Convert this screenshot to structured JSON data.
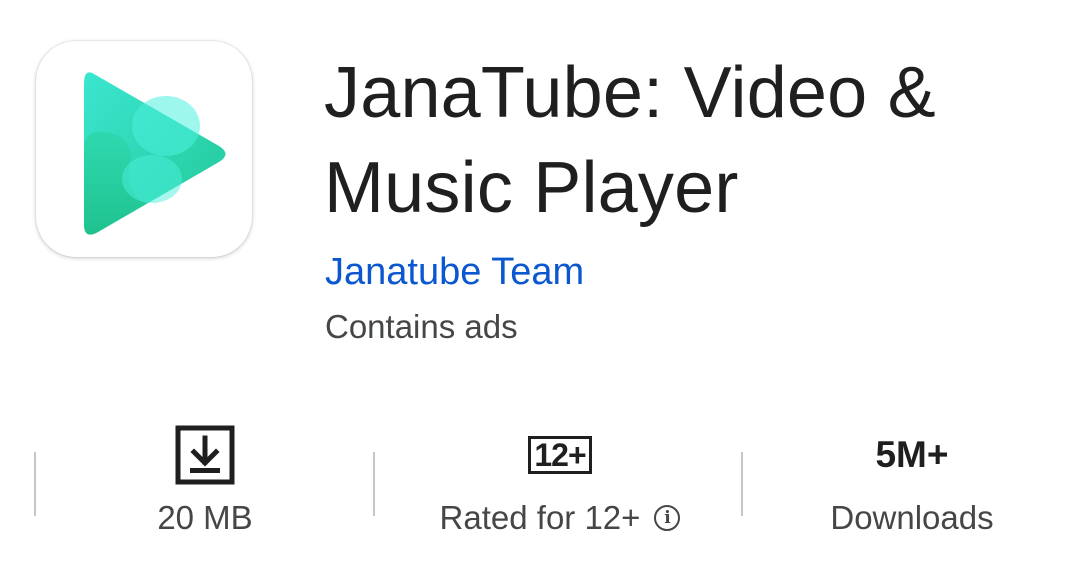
{
  "app": {
    "title": "JanaTube: Video & Music Player",
    "developer": "Janatube Team",
    "ads_note": "Contains ads",
    "icon": "play-triangle-logo",
    "brand_colors": [
      "#2fe0b9",
      "#29c9a0",
      "#3de8d3"
    ]
  },
  "stats": {
    "size": {
      "icon": "download-icon",
      "label": "20 MB"
    },
    "rating": {
      "badge": "12+",
      "label": "Rated for 12+",
      "info_icon": "info-icon"
    },
    "downloads": {
      "value": "5M+",
      "label": "Downloads"
    }
  },
  "colors": {
    "developer_link": "#0b57d0",
    "secondary_text": "#444746",
    "divider": "#c4c7c5"
  }
}
